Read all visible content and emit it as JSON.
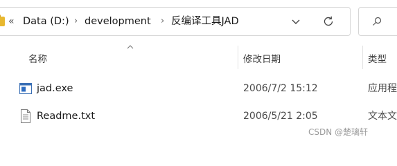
{
  "address_bar": {
    "overflow_chevron": "«",
    "separator": "›",
    "breadcrumbs": [
      {
        "label": "Data (D:)"
      },
      {
        "label": "development"
      },
      {
        "label": "反编译工具JAD"
      }
    ]
  },
  "columns": {
    "name": "名称",
    "modified": "修改日期",
    "type": "类型"
  },
  "files": [
    {
      "name": "jad.exe",
      "modified": "2006/7/2 15:12",
      "type": "应用程",
      "icon": "application-icon"
    },
    {
      "name": "Readme.txt",
      "modified": "2006/5/21 2:05",
      "type": "文本文",
      "icon": "text-file-icon"
    }
  ],
  "watermark": "CSDN @楚璃轩",
  "colors": {
    "border": "#d6d6d6",
    "folder": "#e8b830",
    "exe_blue": "#2d6cc0"
  }
}
